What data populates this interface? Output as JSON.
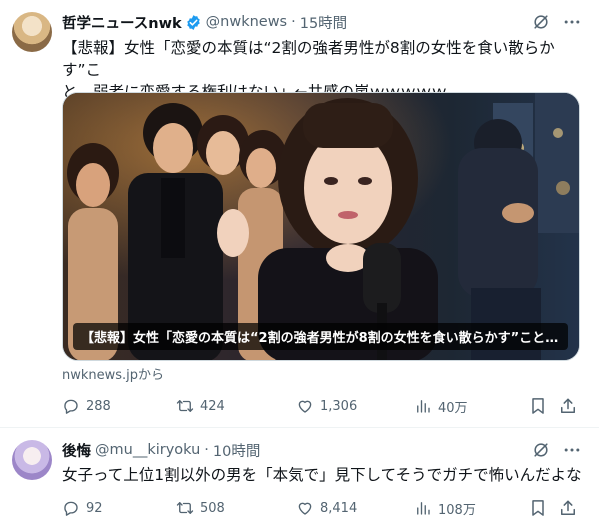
{
  "tweets": [
    {
      "author_name": "哲学ニュースnwk",
      "handle": "@nwknews",
      "separator": "·",
      "time": "15時間",
      "text_line1": "【悲報】女性「恋愛の本質は“2割の強者男性が8割の女性を食い散らかす”こ",
      "text_line2": "と。弱者に恋愛する権利はない」←共感の嵐ｗｗｗｗｗ",
      "card_caption": "【悲報】女性「恋愛の本質は“2割の強者男性が8割の女性を食い散らかす”こと。...",
      "source": "nwknews.jpから",
      "replies": "288",
      "retweets": "424",
      "likes": "1,306",
      "views": "40万",
      "verified_color": "#1d9bf0"
    },
    {
      "author_name": "後悔",
      "handle": "@mu__kiryoku",
      "separator": "·",
      "time": "10時間",
      "text_line1": "女子って上位1割以外の男を「本気で」見下してそうでガチで怖いんだよな",
      "replies": "92",
      "retweets": "508",
      "likes": "8,414",
      "views": "108万"
    }
  ],
  "icons": {
    "reply": "reply-icon",
    "retweet": "retweet-icon",
    "like": "heart-icon",
    "views": "views-icon",
    "bookmark": "bookmark-icon",
    "share": "share-icon",
    "grok": "grok-icon",
    "more": "more-icon"
  },
  "colors": {
    "text": "#0f1419",
    "secondary": "#536471",
    "accent": "#1d9bf0",
    "border": "#eff3f4"
  }
}
